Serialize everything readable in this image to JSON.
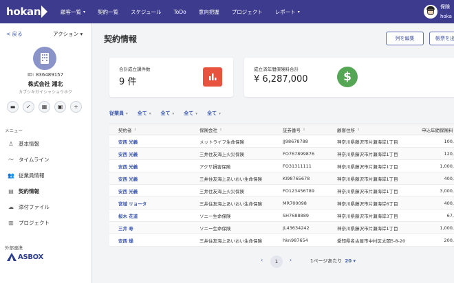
{
  "app": {
    "logo_text": "hokan"
  },
  "nav": [
    {
      "label": "顧客一覧",
      "caret": "▾"
    },
    {
      "label": "契約一覧",
      "caret": ""
    },
    {
      "label": "スケジュール",
      "caret": ""
    },
    {
      "label": "ToDo",
      "caret": ""
    },
    {
      "label": "意向把握",
      "caret": ""
    },
    {
      "label": "プロジェクト",
      "caret": ""
    },
    {
      "label": "レポート",
      "caret": "▾"
    }
  ],
  "user": {
    "line1": "保険",
    "line2": "hoka"
  },
  "sidebar": {
    "back_label": "< 戻る",
    "action_label": "アクション ▾",
    "company_id": "ID: 836489157",
    "company_name": "株式会社 湘北",
    "company_kana": "カブシキガイシャショウホク",
    "quick_icons": [
      "chat-icon",
      "check-icon",
      "calendar-icon",
      "contact-card-icon",
      "plus-icon"
    ],
    "quick_glyphs": [
      "▬",
      "✓",
      "▦",
      "▣",
      "+"
    ],
    "menu_label": "メニュー",
    "menu": [
      {
        "label": "基本情報",
        "icon": "person-icon",
        "glyph": "♙"
      },
      {
        "label": "タイムライン",
        "icon": "timeline-icon",
        "glyph": "〜"
      },
      {
        "label": "従業員情報",
        "icon": "employees-icon",
        "glyph": "👥"
      },
      {
        "label": "契約情報",
        "icon": "contract-icon",
        "glyph": "▤"
      },
      {
        "label": "添付ファイル",
        "icon": "cloud-upload-icon",
        "glyph": "☁"
      },
      {
        "label": "プロジェクト",
        "icon": "clipboard-icon",
        "glyph": "▥"
      }
    ],
    "external_label": "外部連携",
    "asbox_text": "ASBOX"
  },
  "main": {
    "title": "契約情報",
    "edit_columns_label": "列を編集",
    "form_output_label": "帳票を出"
  },
  "cards": [
    {
      "label": "合計成立課件数",
      "value": "9 件",
      "icon": "bar-chart-icon",
      "color": "#e8533f"
    },
    {
      "label": "成立済年間保険料合計",
      "value": "¥ 6,287,000",
      "icon": "dollar-icon",
      "color": "#55a655"
    }
  ],
  "filters": [
    {
      "label": "従業員"
    },
    {
      "label": "全て"
    },
    {
      "label": "全て"
    },
    {
      "label": "全て"
    },
    {
      "label": "全て"
    }
  ],
  "filter_caret": "▾",
  "table": {
    "headers": [
      "契約者",
      "保険会社",
      "証券番号",
      "顧客住所",
      "申込年間保険料"
    ],
    "sort_icon": "⇕",
    "rows": [
      [
        "安西 光義",
        "メットライフ生命保険",
        "JJ98678788",
        "神奈川県藤沢市片瀬海岸1丁目",
        "100,"
      ],
      [
        "安西 光義",
        "三井住友海上火災保険",
        "FO767899876",
        "神奈川県藤沢市片瀬海岸1丁目",
        "120,"
      ],
      [
        "安西 光義",
        "アクサ損害保険",
        "FO31311111",
        "神奈川県藤沢市片瀬海岸1丁目",
        "1,000,"
      ],
      [
        "安西 光義",
        "三井住友海上あいおい生命保険",
        "KI98765678",
        "神奈川県藤沢市片瀬海岸1丁目",
        "400,"
      ],
      [
        "安西 光義",
        "三井住友海上火災保険",
        "FO123456789",
        "神奈川県藤沢市片瀬海岸1丁目",
        "3,000,"
      ],
      [
        "宮城 リョータ",
        "三井住友海上あいおい生命保険",
        "MR700098",
        "神奈川県藤沢市片瀬海岸6丁目",
        "400,"
      ],
      [
        "桜木 花道",
        "ソニー生命保険",
        "SH7688889",
        "神奈川県藤沢市片瀬海岸3丁目",
        "67,"
      ],
      [
        "三井 寿",
        "ソニー生命保険",
        "JL43634242",
        "神奈川県藤沢市片瀬海岸1丁目",
        "1,000,"
      ],
      [
        "安西 燥",
        "三井住友海上あいおい生命保険",
        "hkn987654",
        "愛知県名古屋市中村区太閤5-8-20",
        "200,"
      ]
    ]
  },
  "pagination": {
    "prev": "‹",
    "current": "1",
    "next": "›",
    "per_page_label": "1ページあたり",
    "per_page_value": "20 ▾"
  }
}
